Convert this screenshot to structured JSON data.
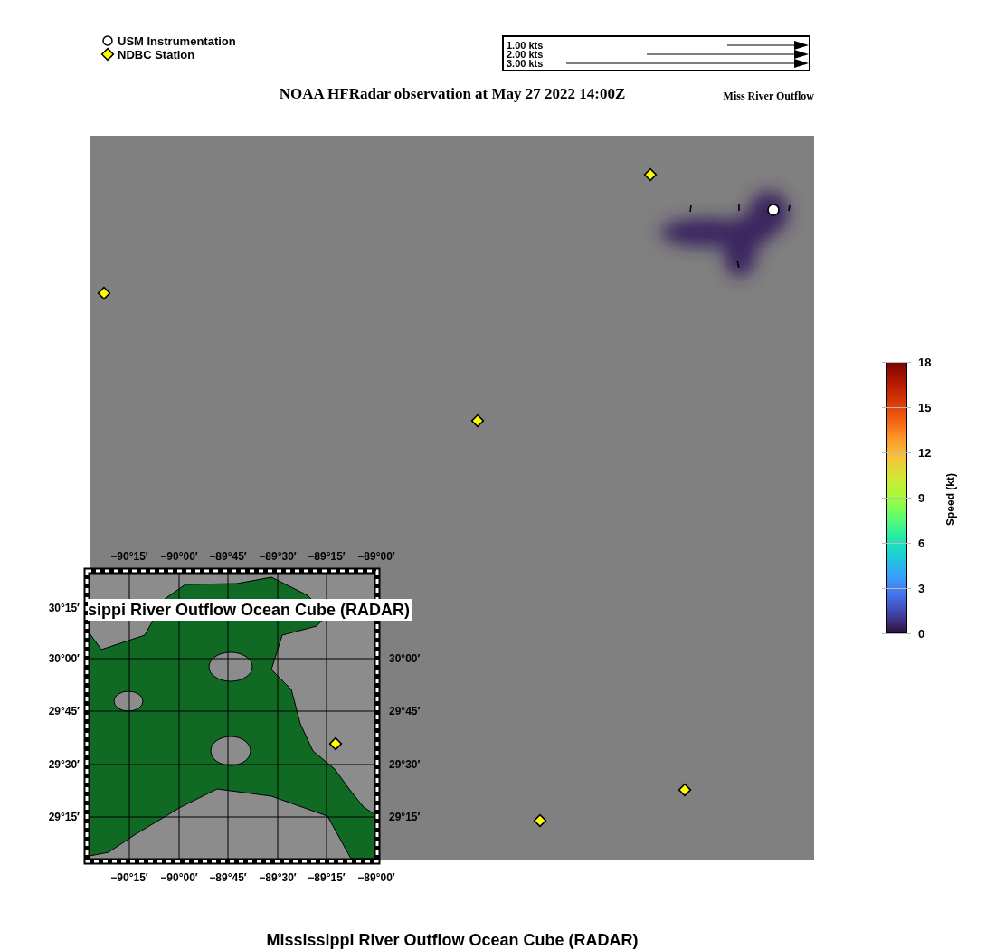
{
  "legend": [
    {
      "kind": "circle",
      "label": "USM Instrumentation"
    },
    {
      "kind": "diamond",
      "label": "NDBC Station"
    }
  ],
  "vector_scale": [
    "1.00 kts",
    "2.00 kts",
    "3.00 kts"
  ],
  "title": "NOAA HFRadar observation at May 27 2022 14:00Z",
  "subtitle": "Miss River Outflow",
  "colorbar": {
    "label": "Speed (kt)",
    "ticks": [
      "18",
      "15",
      "12",
      "9",
      "6",
      "3",
      "0"
    ]
  },
  "inset": {
    "title": "sippi River Outflow Ocean Cube (RADAR)",
    "top_ticks": [
      "−90°15′",
      "−90°00′",
      "−89°45′",
      "−89°30′",
      "−89°15′",
      "−89°00′"
    ],
    "bottom_ticks": [
      "−90°15′",
      "−90°00′",
      "−89°45′",
      "−89°30′",
      "−89°15′",
      "−89°00′"
    ],
    "left_ticks": [
      "30°15′",
      "30°00′",
      "29°45′",
      "29°30′",
      "29°15′"
    ],
    "right_ticks": [
      "30°00′",
      "29°45′",
      "29°30′",
      "29°15′"
    ]
  },
  "footer": "Mississippi River Outflow Ocean Cube (RADAR)"
}
